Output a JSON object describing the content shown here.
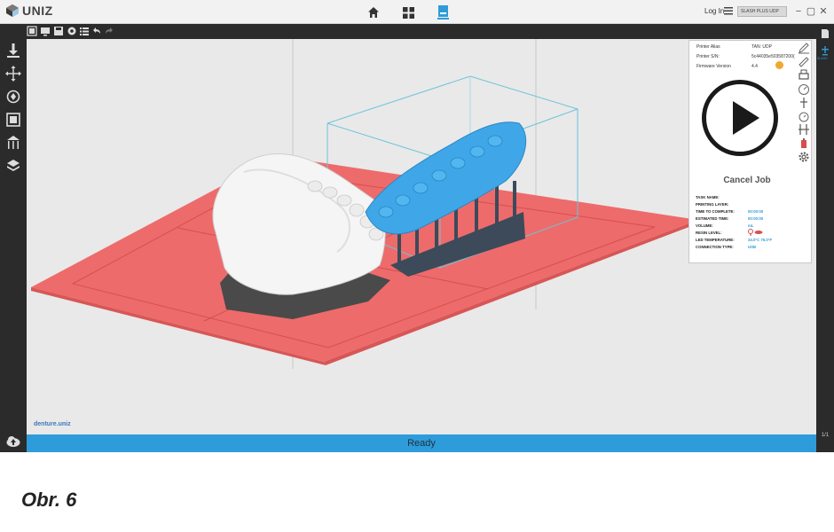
{
  "app": {
    "logo_text": "UNIZ"
  },
  "header": {
    "login_label": "Log In",
    "printer_selector": "SLASH PLUS UDP",
    "nav": [
      "home-icon",
      "grid-icon",
      "printer-icon"
    ],
    "window_controls": [
      "−",
      "▢",
      "✕"
    ]
  },
  "toolbar": {
    "icons": [
      "add-model-icon",
      "monitor-icon",
      "save-icon",
      "settings-icon",
      "list-icon",
      "undo-icon",
      "redo-icon"
    ]
  },
  "left_tools": {
    "icons": [
      "import-icon",
      "move-icon",
      "rotate-icon",
      "scale-icon",
      "support-icon",
      "slice-icon"
    ]
  },
  "viewport": {
    "filename": "denture.uniz",
    "build_plate_color": "#ee6b6b",
    "selected_model_color": "#3fa7e8",
    "model_color": "#f5f5f5",
    "support_color": "#4a4a4a",
    "bbox_color": "#6cc3d8"
  },
  "printer_panel": {
    "rows": [
      {
        "label": "Printer Alias",
        "value": "TAN: UDP"
      },
      {
        "label": "Printer S/N:",
        "value": "5c44035e503587200("
      },
      {
        "label": "Firmware Version",
        "value": "4.4"
      }
    ],
    "cancel_label": "Cancel Job",
    "info": [
      {
        "label": "TASK NAME:",
        "value": ""
      },
      {
        "label": "PRINTING LAYER:",
        "value": ""
      },
      {
        "label": "TIME TO COMPLETE:",
        "value": "00:00:00"
      },
      {
        "label": "ESTIMATED TIME:",
        "value": "00:00:00"
      },
      {
        "label": "VOLUME:",
        "value": "mL"
      },
      {
        "label": "RESIN LEVEL:",
        "value": ""
      },
      {
        "label": "LED TEMPERATURE:",
        "value": "24.0°C 75.0°F"
      },
      {
        "label": "CONNECTION TYPE:",
        "value": "USB"
      }
    ]
  },
  "status": {
    "text": "Ready"
  },
  "right_bar": {
    "top_label": "SLASH",
    "page": "1/1"
  },
  "caption": "Obr. 6"
}
